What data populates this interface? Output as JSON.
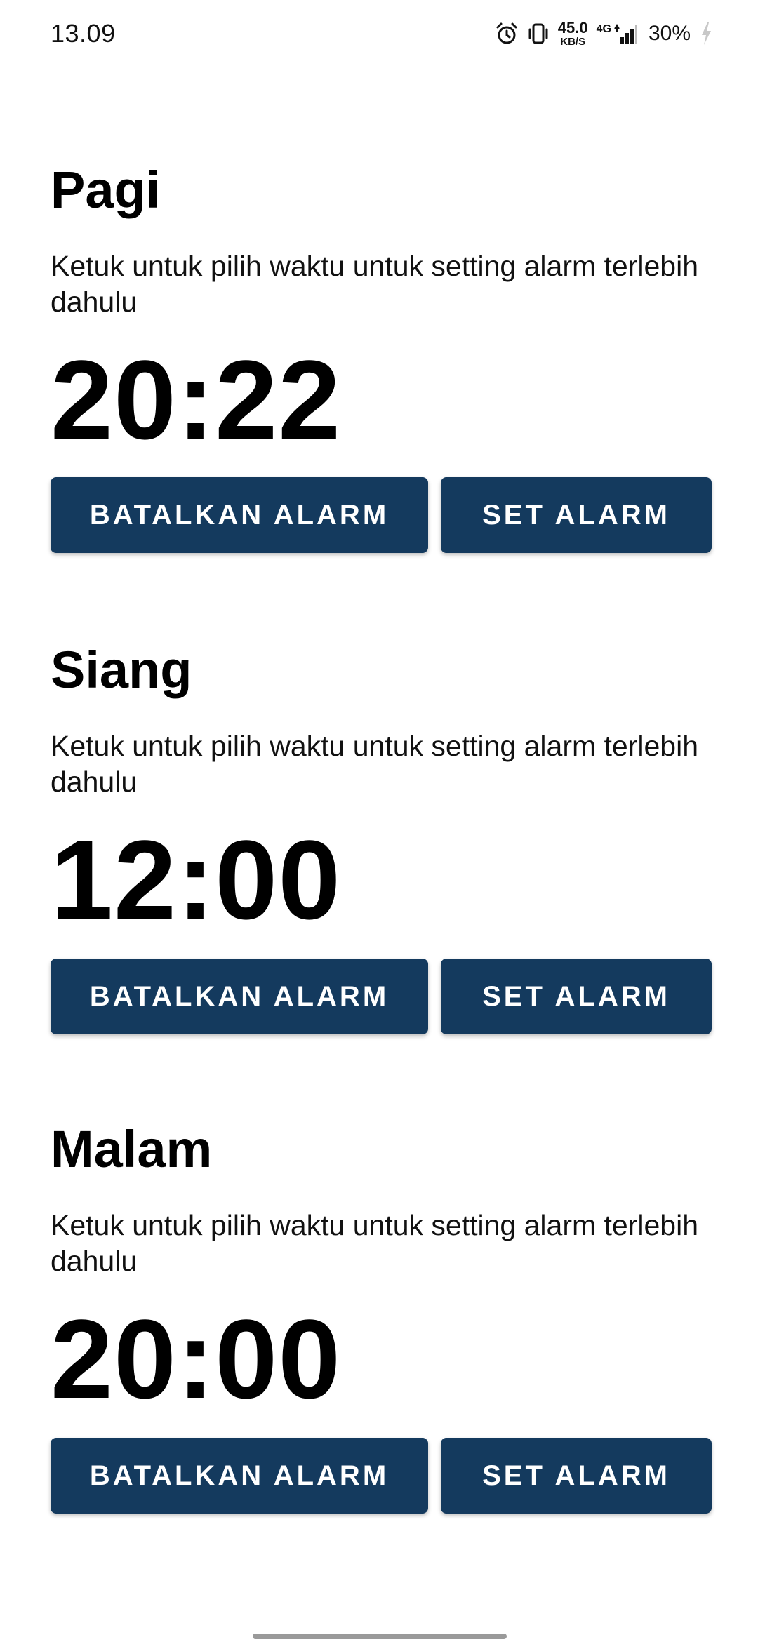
{
  "status_bar": {
    "time": "13.09",
    "net_speed_value": "45.0",
    "net_speed_unit": "KB/S",
    "network_type": "4G",
    "battery": "30%",
    "icons": [
      "alarm-icon",
      "vibrate-icon",
      "signal-icon",
      "battery-charging-icon"
    ]
  },
  "alarms": [
    {
      "title": "Pagi",
      "hint": "Ketuk untuk pilih waktu untuk setting alarm terlebih dahulu",
      "time": "20:22",
      "cancel_label": "BATALKAN ALARM",
      "set_label": "SET ALARM"
    },
    {
      "title": "Siang",
      "hint": "Ketuk untuk pilih waktu untuk setting alarm terlebih dahulu",
      "time": "12:00",
      "cancel_label": "BATALKAN ALARM",
      "set_label": "SET ALARM"
    },
    {
      "title": "Malam",
      "hint": "Ketuk untuk pilih waktu untuk setting alarm terlebih dahulu",
      "time": "20:00",
      "cancel_label": "BATALKAN ALARM",
      "set_label": "SET ALARM"
    }
  ],
  "colors": {
    "button_background": "#143a5e",
    "button_text": "#ffffff",
    "page_background": "#ffffff"
  }
}
